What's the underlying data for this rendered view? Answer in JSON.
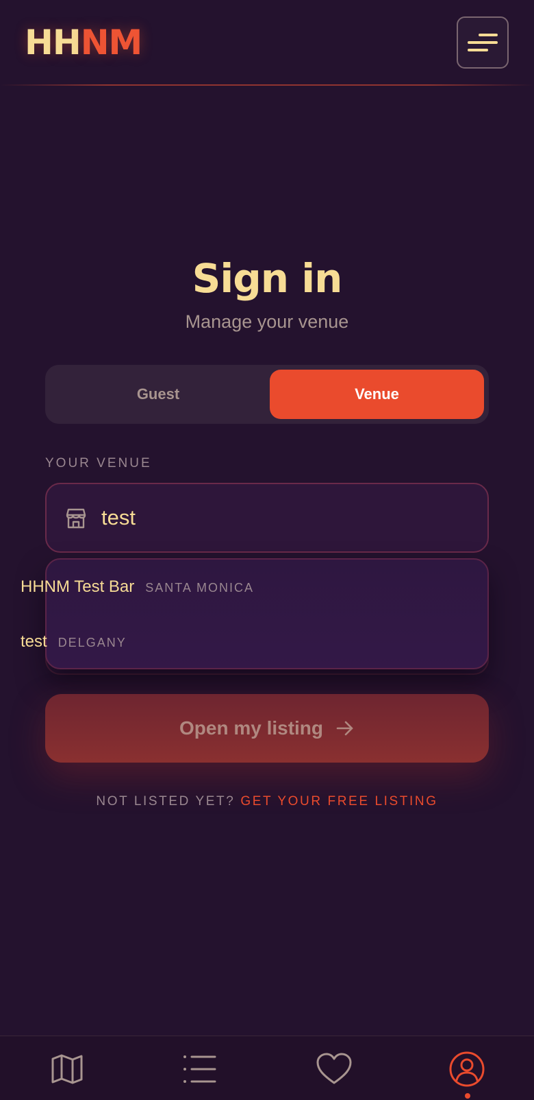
{
  "header": {
    "logo_part1": "HH",
    "logo_part2": "NM"
  },
  "signin": {
    "title": "Sign in",
    "subtitle": "Manage your venue"
  },
  "toggle": {
    "guest_label": "Guest",
    "venue_label": "Venue",
    "selected": "Venue"
  },
  "venue_field": {
    "label": "YOUR VENUE",
    "value": "test",
    "icon": "storefront-icon"
  },
  "suggestions": [
    {
      "name": "HHNM Test Bar",
      "location": "SANTA MONICA"
    },
    {
      "name": "test",
      "location": "DELGANY"
    }
  ],
  "cta": {
    "label": "Open my listing"
  },
  "footer_prompt": {
    "question": "NOT LISTED YET?",
    "link": "GET YOUR FREE LISTING"
  },
  "nav": {
    "items": [
      "map-icon",
      "list-icon",
      "heart-icon",
      "account-icon"
    ],
    "active": "account-icon"
  },
  "colors": {
    "background": "#24122e",
    "accent": "#ea4b2d",
    "cream": "#f7dc95",
    "muted": "#9a8790"
  }
}
